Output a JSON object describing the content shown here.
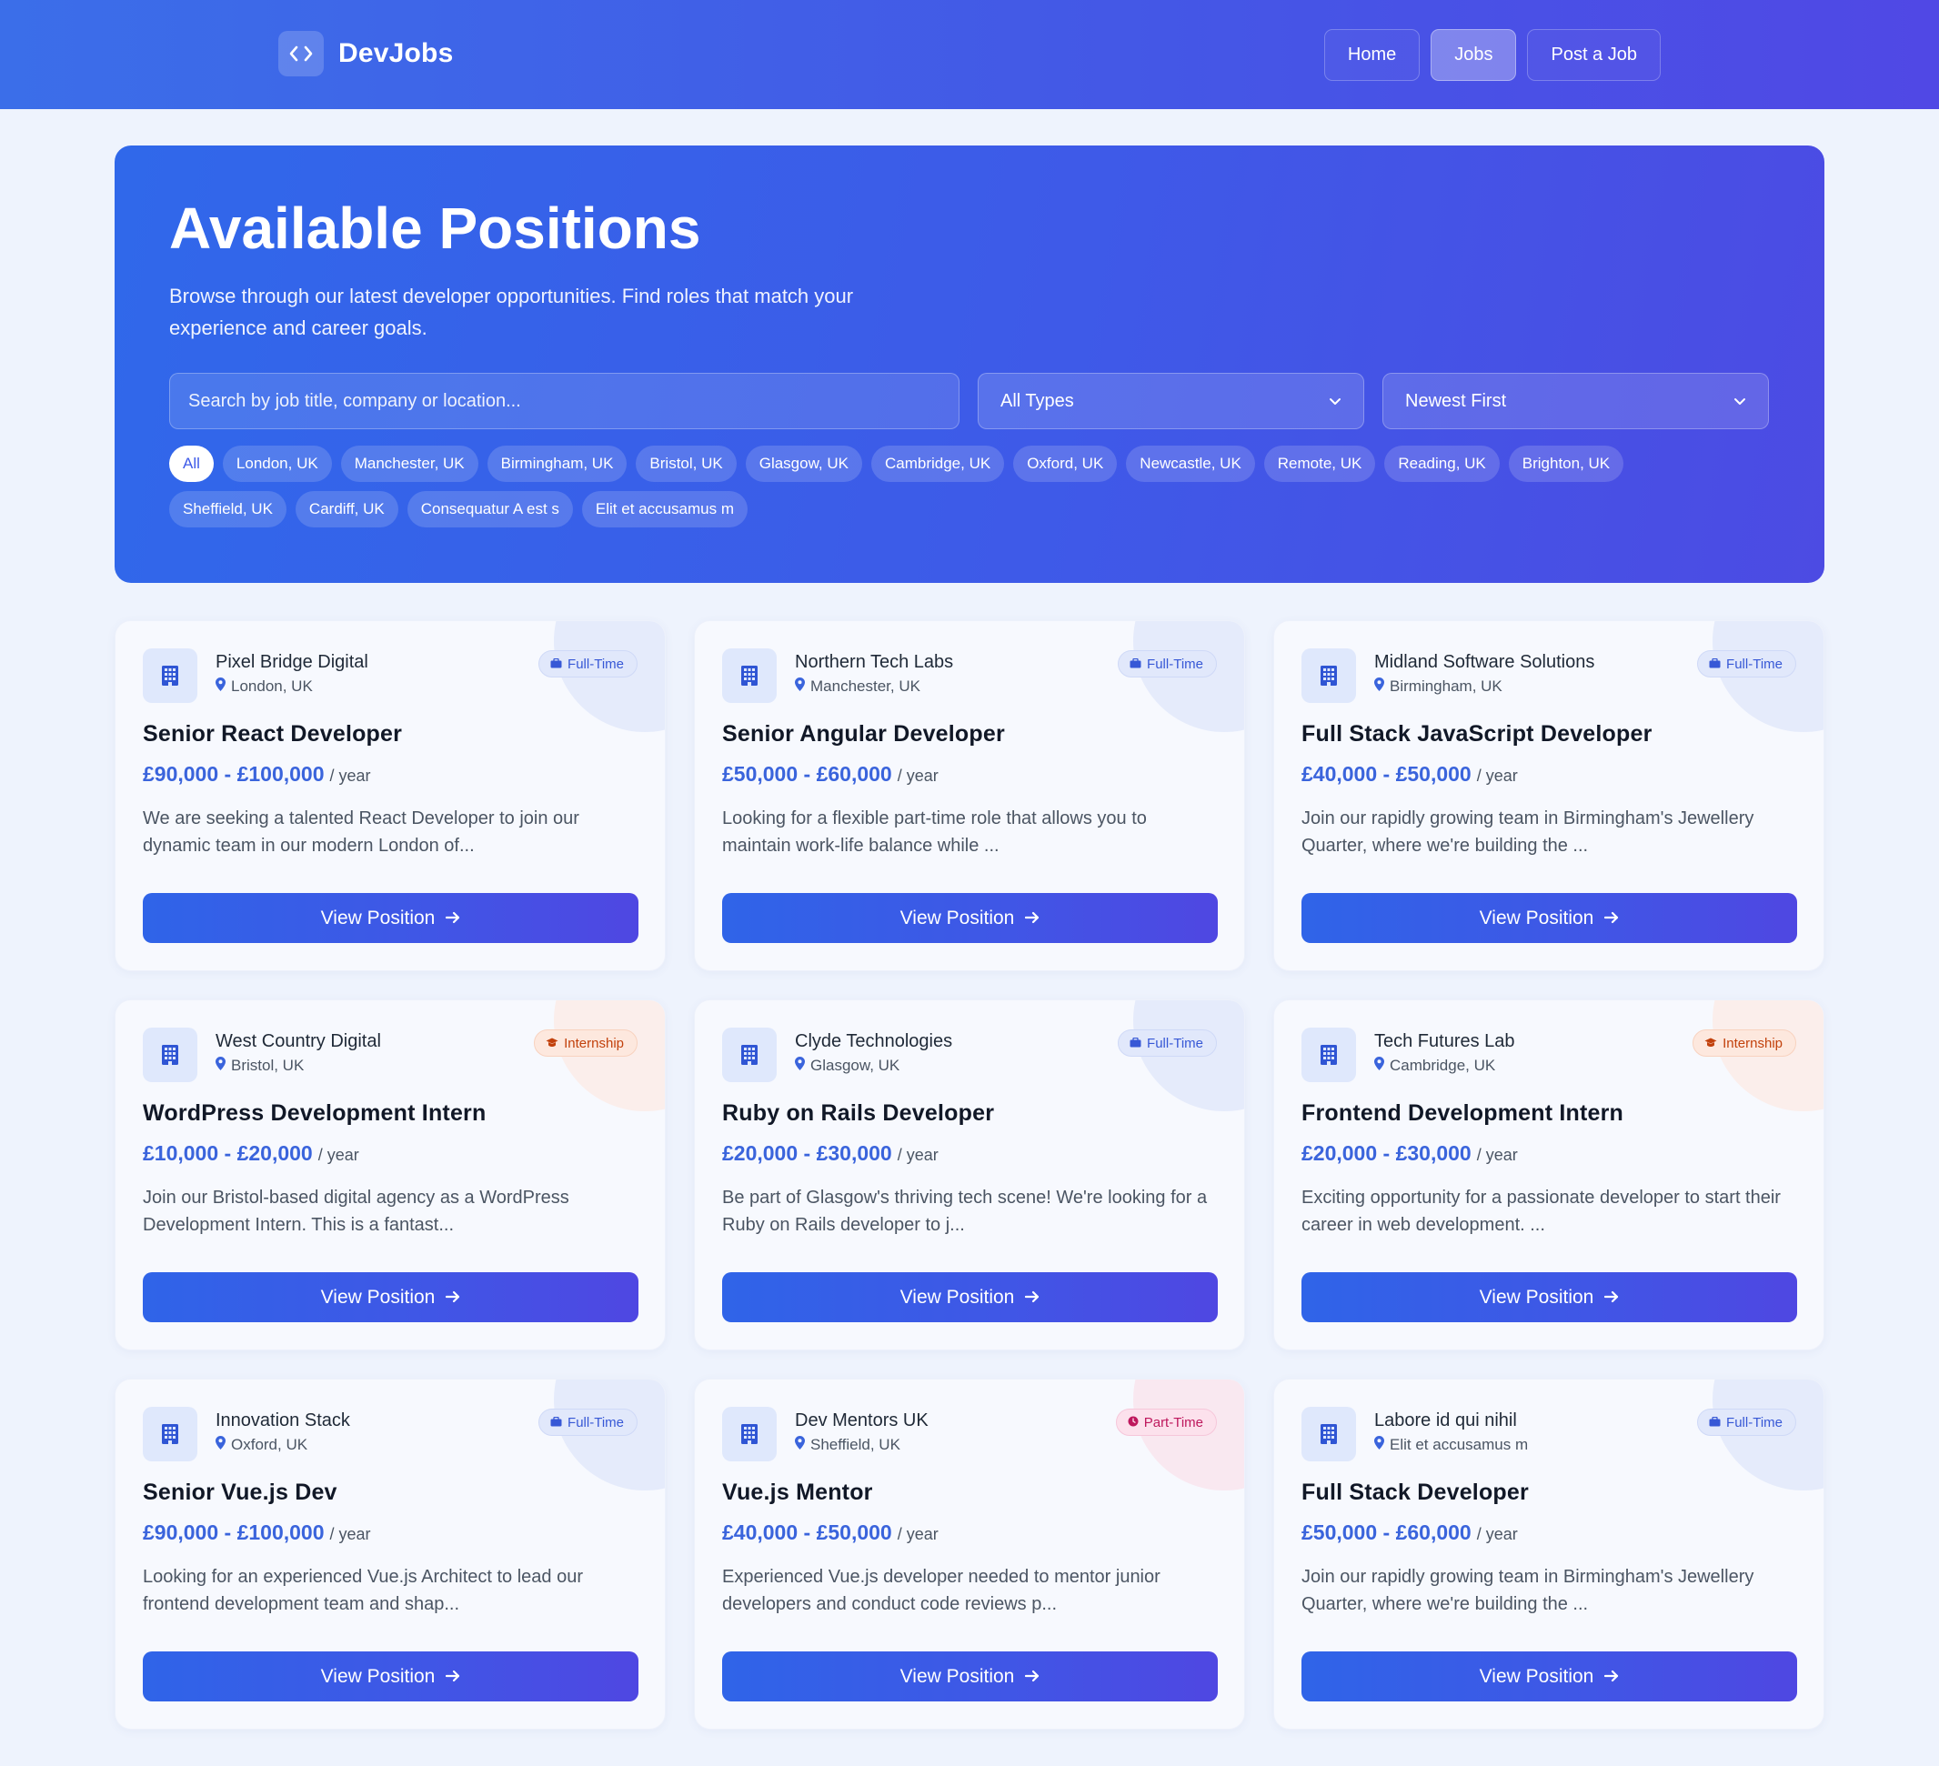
{
  "header": {
    "brand": "DevJobs",
    "nav": [
      {
        "label": "Home",
        "active": false
      },
      {
        "label": "Jobs",
        "active": true
      },
      {
        "label": "Post a Job",
        "active": false
      }
    ]
  },
  "hero": {
    "title": "Available Positions",
    "subtitle": "Browse through our latest developer opportunities. Find roles that match your experience and career goals.",
    "search_placeholder": "Search by job title, company or location...",
    "type_filter": "All Types",
    "sort": "Newest First",
    "locations": [
      "All",
      "London, UK",
      "Manchester, UK",
      "Birmingham, UK",
      "Bristol, UK",
      "Glasgow, UK",
      "Cambridge, UK",
      "Oxford, UK",
      "Newcastle, UK",
      "Remote, UK",
      "Reading, UK",
      "Brighton, UK",
      "Sheffield, UK",
      "Cardiff, UK",
      "Consequatur A est s",
      "Elit et accusamus m"
    ],
    "active_location": "All"
  },
  "jobs": [
    {
      "company": "Pixel Bridge Digital",
      "location": "London, UK",
      "type": "Full-Time",
      "type_key": "ft",
      "title": "Senior React Developer",
      "salary": "£90,000 - £100,000",
      "per": "/ year",
      "description": "We are seeking a talented React Developer to join our dynamic team in our modern London of...",
      "cta": "View Position"
    },
    {
      "company": "Northern Tech Labs",
      "location": "Manchester, UK",
      "type": "Full-Time",
      "type_key": "ft",
      "title": "Senior Angular Developer",
      "salary": "£50,000 - £60,000",
      "per": "/ year",
      "description": "Looking for a flexible part-time role that allows you to maintain work-life balance while ...",
      "cta": "View Position"
    },
    {
      "company": "Midland Software Solutions",
      "location": "Birmingham, UK",
      "type": "Full-Time",
      "type_key": "ft",
      "title": "Full Stack JavaScript Developer",
      "salary": "£40,000 - £50,000",
      "per": "/ year",
      "description": "Join our rapidly growing team in Birmingham's Jewellery Quarter, where we're building the ...",
      "cta": "View Position"
    },
    {
      "company": "West Country Digital",
      "location": "Bristol, UK",
      "type": "Internship",
      "type_key": "in",
      "title": "WordPress Development Intern",
      "salary": "£10,000 - £20,000",
      "per": "/ year",
      "description": "Join our Bristol-based digital agency as a WordPress Development Intern. This is a fantast...",
      "cta": "View Position"
    },
    {
      "company": "Clyde Technologies",
      "location": "Glasgow, UK",
      "type": "Full-Time",
      "type_key": "ft",
      "title": "Ruby on Rails Developer",
      "salary": "£20,000 - £30,000",
      "per": "/ year",
      "description": "Be part of Glasgow's thriving tech scene! We're looking for a Ruby on Rails developer to j...",
      "cta": "View Position"
    },
    {
      "company": "Tech Futures Lab",
      "location": "Cambridge, UK",
      "type": "Internship",
      "type_key": "in",
      "title": "Frontend Development Intern",
      "salary": "£20,000 - £30,000",
      "per": "/ year",
      "description": "Exciting opportunity for a passionate developer to start their career in web development. ...",
      "cta": "View Position"
    },
    {
      "company": "Innovation Stack",
      "location": "Oxford, UK",
      "type": "Full-Time",
      "type_key": "ft",
      "title": "Senior Vue.js Dev",
      "salary": "£90,000 - £100,000",
      "per": "/ year",
      "description": "Looking for an experienced Vue.js Architect to lead our frontend development team and shap...",
      "cta": "View Position"
    },
    {
      "company": "Dev Mentors UK",
      "location": "Sheffield, UK",
      "type": "Part-Time",
      "type_key": "pt",
      "title": "Vue.js Mentor",
      "salary": "£40,000 - £50,000",
      "per": "/ year",
      "description": "Experienced Vue.js developer needed to mentor junior developers and conduct code reviews p...",
      "cta": "View Position"
    },
    {
      "company": "Labore id qui nihil",
      "location": "Elit et accusamus m",
      "type": "Full-Time",
      "type_key": "ft",
      "title": "Full Stack Developer",
      "salary": "£50,000 - £60,000",
      "per": "/ year",
      "description": "Join our rapidly growing team in Birmingham's Jewellery Quarter, where we're building the ...",
      "cta": "View Position"
    }
  ],
  "colors": {
    "primary": "#3e5ae8",
    "fulltime": "#3758d6",
    "internship": "#c2410c",
    "parttime": "#be185d",
    "salary": "#3a64dc"
  },
  "icons": {
    "brand": "code-icon",
    "company": "building-icon",
    "location": "map-pin-icon",
    "fulltime": "briefcase-icon",
    "internship": "graduation-cap-icon",
    "parttime": "clock-icon",
    "cta": "arrow-right-icon",
    "select": "chevron-down-icon"
  }
}
